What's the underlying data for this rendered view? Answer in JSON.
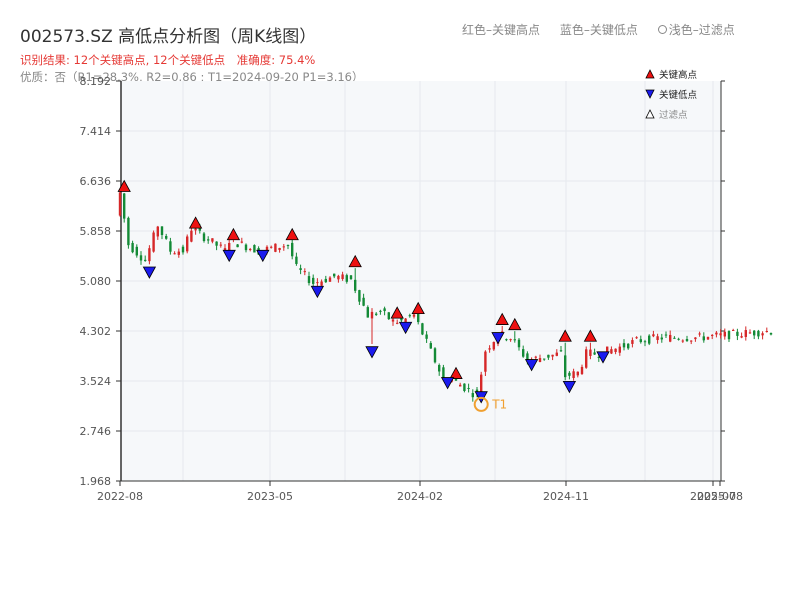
{
  "header": {
    "title": "002573.SZ 高低点分析图（周K线图）",
    "legend_red": "红色–关键高点",
    "legend_blue": "蓝色–关键低点",
    "legend_light": "浅色–过滤点",
    "result": "识别结果: 12个关键高点, 12个关键低点",
    "accuracy": "准确度: 75.4%",
    "quality": "优质：否（R1=28.3%, R2=0.86 ; T1=2024-09-20 P1=3.16）"
  },
  "colors": {
    "up": "#d62728",
    "down": "#138a36",
    "high_marker": "#ee1111",
    "low_marker": "#1a1aee",
    "t1": "#f0a030",
    "grid": "#e6e9ee",
    "plot_bg": "#f6f8fa",
    "axis": "#333333"
  },
  "chart_data": {
    "type": "candlestick",
    "interval": "weekly",
    "ylim": [
      1.968,
      8.192
    ],
    "yticks": [
      "1.968",
      "2.746",
      "3.524",
      "4.302",
      "5.080",
      "5.858",
      "6.636",
      "7.414",
      "8.192"
    ],
    "xticks": [
      "2022-08",
      "2023-05",
      "2024-02",
      "2024-11",
      "2025-07",
      "2025-08"
    ],
    "grid": true,
    "legend_position": "top-right",
    "legend": [
      "关键高点",
      "关键低点",
      "过滤点"
    ],
    "key_highs": [
      {
        "i": 1,
        "v": 6.55
      },
      {
        "i": 18,
        "v": 5.98
      },
      {
        "i": 27,
        "v": 5.8
      },
      {
        "i": 41,
        "v": 5.8
      },
      {
        "i": 56,
        "v": 5.38
      },
      {
        "i": 66,
        "v": 4.58
      },
      {
        "i": 71,
        "v": 4.65
      },
      {
        "i": 80,
        "v": 3.64
      },
      {
        "i": 91,
        "v": 4.48
      },
      {
        "i": 94,
        "v": 4.4
      },
      {
        "i": 106,
        "v": 4.22
      },
      {
        "i": 112,
        "v": 4.22
      }
    ],
    "key_lows": [
      {
        "i": 7,
        "v": 5.22
      },
      {
        "i": 26,
        "v": 5.48
      },
      {
        "i": 34,
        "v": 5.48
      },
      {
        "i": 47,
        "v": 4.92
      },
      {
        "i": 60,
        "v": 3.98
      },
      {
        "i": 68,
        "v": 4.36
      },
      {
        "i": 78,
        "v": 3.5
      },
      {
        "i": 86,
        "v": 3.28
      },
      {
        "i": 90,
        "v": 4.2
      },
      {
        "i": 98,
        "v": 3.78
      },
      {
        "i": 107,
        "v": 3.44
      },
      {
        "i": 115,
        "v": 3.9
      }
    ],
    "t1": {
      "label": "T1",
      "date": "2024-09-20",
      "price": 3.16,
      "i": 86
    }
  }
}
